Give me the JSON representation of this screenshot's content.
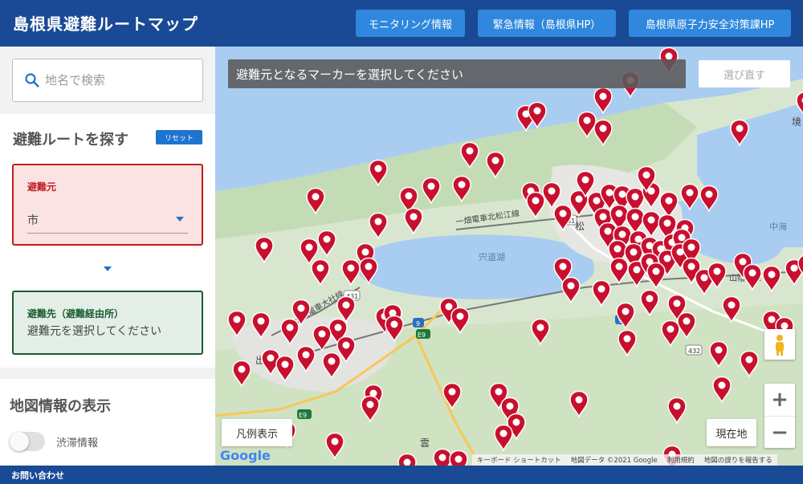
{
  "header": {
    "title": "島根県避難ルートマップ",
    "buttons": [
      "モニタリング情報",
      "緊急情報（島根県HP）",
      "島根県原子力安全対策課HP"
    ]
  },
  "search": {
    "placeholder": "地名で検索",
    "icon": "search-icon"
  },
  "route": {
    "title": "避難ルートを探す",
    "reset_label": "リセット",
    "from_label": "避難元",
    "from_value": "市",
    "to_label": "避難先（避難経由所）",
    "to_value": "避難元を選択してください"
  },
  "info": {
    "title": "地図情報の表示",
    "traffic_label": "渋滞情報",
    "traffic_on": false
  },
  "map": {
    "banner": "避難元となるマーカーを選択してください",
    "reselect_label": "選び直す",
    "legend_label": "凡例表示",
    "current_label": "現在地",
    "zoom_in": "+",
    "zoom_out": "−",
    "google_logo": "Google",
    "attribution": [
      "キーボード ショートカット",
      "地図データ ©2021 Google",
      "利用規約",
      "地図の誤りを報告する"
    ],
    "labels": {
      "lake": "宍道湖",
      "naka": "中海",
      "line_north": "一畑電車北松江線",
      "line_taisha": "一畑電車大社線",
      "sanin": "山陰本線",
      "izumo": "雲",
      "matsue": "松",
      "kyo": "境",
      "izu_small": "出",
      "route431a": "431",
      "route431b": "431",
      "route9a": "9",
      "route9b": "9",
      "e9a": "E9",
      "e9b": "E9",
      "route432": "432"
    },
    "marker_color": "#c8102e"
  },
  "footer": {
    "contact_label": "お問い合わせ"
  },
  "colors": {
    "header": "#1a4a95",
    "button": "#2f88dd",
    "from_border": "#c11d1d",
    "to_border": "#1b5b31"
  }
}
